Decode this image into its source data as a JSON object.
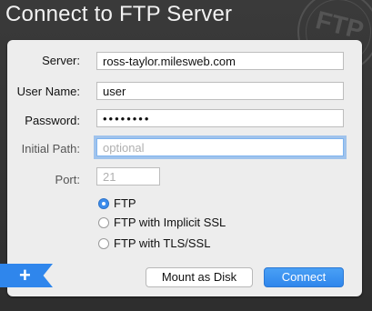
{
  "window": {
    "title": "Connect to FTP Server",
    "watermark": "FTP"
  },
  "form": {
    "server_label": "Server:",
    "server_value": "ross-taylor.milesweb.com",
    "username_label": "User Name:",
    "username_value": "user",
    "password_label": "Password:",
    "password_mask": "••••••••",
    "initial_path_label": "Initial Path:",
    "initial_path_placeholder": "optional",
    "port_label": "Port:",
    "port_placeholder": "21"
  },
  "protocol": {
    "options": [
      {
        "label": "FTP",
        "selected": true
      },
      {
        "label": "FTP with Implicit SSL",
        "selected": false
      },
      {
        "label": "FTP with TLS/SSL",
        "selected": false
      }
    ]
  },
  "buttons": {
    "mount_label": "Mount as Disk",
    "connect_label": "Connect",
    "add_label": "+"
  },
  "colors": {
    "accent": "#2f86ec",
    "focus_ring": "#60a0eb"
  }
}
